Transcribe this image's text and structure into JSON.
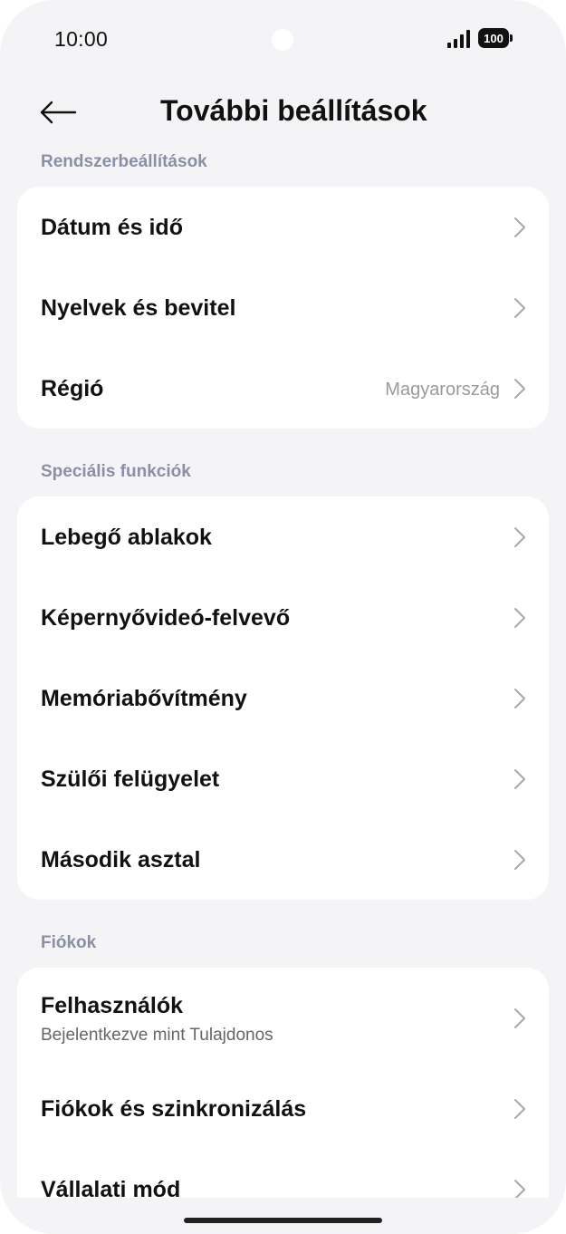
{
  "status_bar": {
    "time": "10:00",
    "battery": "100",
    "icons": [
      "signal-icon",
      "battery-icon"
    ]
  },
  "header": {
    "title": "További beállítások",
    "back_icon": "arrow-left-icon"
  },
  "sections": {
    "system": {
      "label": "Rendszerbeállítások",
      "items": {
        "date_time": {
          "title": "Dátum és idő"
        },
        "languages": {
          "title": "Nyelvek és bevitel"
        },
        "region": {
          "title": "Régió",
          "value": "Magyarország"
        }
      }
    },
    "special": {
      "label": "Speciális funkciók",
      "items": {
        "floating_windows": {
          "title": "Lebegő ablakok"
        },
        "screen_recorder": {
          "title": "Képernyővideó-felvevő"
        },
        "memory_extension": {
          "title": "Memóriabővítmény"
        },
        "parental_control": {
          "title": "Szülői felügyelet"
        },
        "second_desktop": {
          "title": "Második asztal"
        }
      }
    },
    "accounts": {
      "label": "Fiókok",
      "items": {
        "users": {
          "title": "Felhasználók",
          "subtitle": "Bejelentkezve mint Tulajdonos"
        },
        "accounts_sync": {
          "title": "Fiókok és szinkronizálás"
        },
        "enterprise_mode": {
          "title": "Vállalati mód"
        }
      }
    }
  },
  "colors": {
    "background": "#f4f4f6",
    "card": "#ffffff",
    "section_label": "#8a8fa5",
    "text": "#111111",
    "secondary_text": "#9a9a9a"
  }
}
